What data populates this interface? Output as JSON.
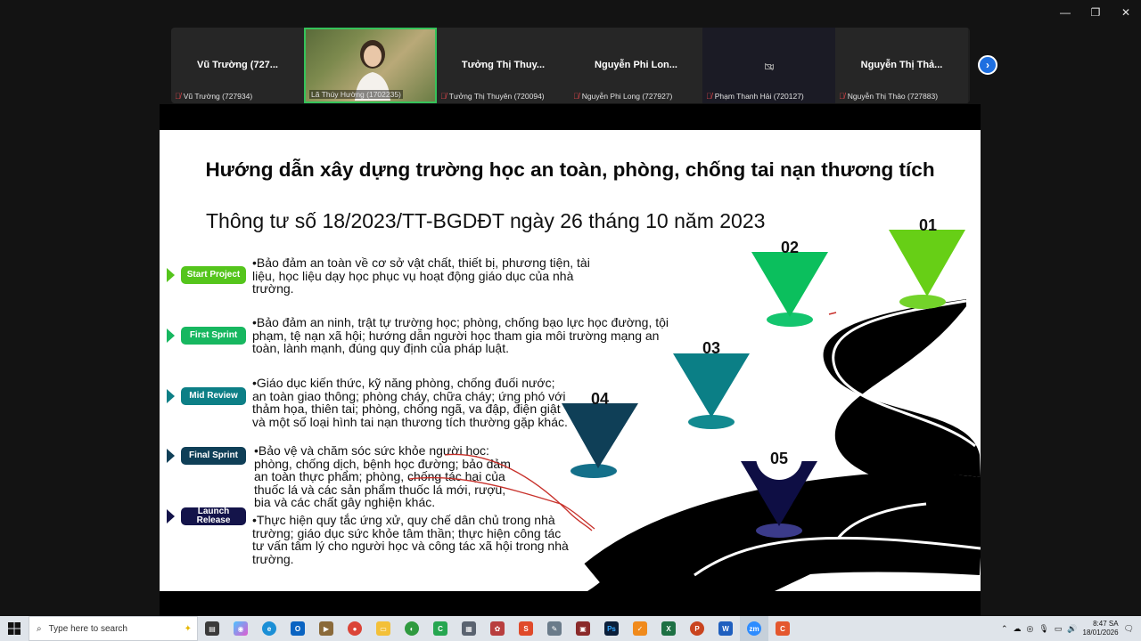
{
  "window": {
    "minimize": "—",
    "restore": "❐",
    "close": "✕"
  },
  "participants": [
    {
      "name": "Vũ Trường (727...",
      "label": "Vũ Trường (727934)",
      "type": "name"
    },
    {
      "name": "",
      "label": "Lã Thúy Hường (1702235)",
      "type": "video"
    },
    {
      "name": "Tưởng Thị Thuy...",
      "label": "Tưởng Thị Thuyên (720094)",
      "type": "name"
    },
    {
      "name": "Nguyễn Phi Lon...",
      "label": "Nguyễn Phi Long (727927)",
      "type": "name"
    },
    {
      "name": "",
      "label": "Phạm Thanh Hải (720127)",
      "type": "camoff"
    },
    {
      "name": "Nguyễn Thị Thả...",
      "label": "Nguyễn Thị Thảo (727883)",
      "type": "name"
    }
  ],
  "slide": {
    "title": "Hướng dẫn xây dựng trường học an toàn, phòng, chống tai nạn thương tích",
    "subtitle": "Thông tư số 18/2023/TT-BGDĐT ngày 26 tháng 10 năm 2023",
    "steps": [
      {
        "label": "Start Project",
        "color": "#55c51c"
      },
      {
        "label": "First Sprint",
        "color": "#17b760"
      },
      {
        "label": "Mid Review",
        "color": "#0d7f86"
      },
      {
        "label": "Final Sprint",
        "color": "#0f3f57"
      },
      {
        "label": "Launch Release",
        "color": "#14144a"
      }
    ],
    "paragraphs": [
      "•Bảo đảm an toàn về cơ sở vật chất, thiết bị, phương tiện, tài liệu, học liệu dạy học phục vụ hoạt động giáo dục của nhà trường.",
      "•Bảo đảm an ninh, trật tự trường học; phòng, chống bạo lực học đường, tội phạm, tệ nạn xã hội; hướng dẫn người học tham gia môi trường mạng an toàn, lành mạnh, đúng quy định của pháp luật.",
      "•Giáo dục kiến thức, kỹ năng phòng, chống đuối nước; an toàn giao thông; phòng cháy, chữa cháy; ứng phó với thảm họa, thiên tai; phòng, chống ngã, va đập, điện giật và một số loại hình tai nạn thương tích thường gặp khác.",
      "•Bảo vệ và chăm sóc sức khỏe người học: phòng, chống dịch, bệnh học đường; bảo đảm an toàn thực phẩm; phòng, chống tác hại của thuốc lá và các sản phẩm thuốc lá mới, rượu, bia và các chất gây nghiện khác.",
      "•Thực hiện quy tắc ứng xử, quy chế dân chủ trong nhà trường; giáo dục sức khỏe tâm thần; thực hiện công tác tư vấn tâm lý cho người học và công tác xã hội trong nhà trường."
    ],
    "numbers": [
      "01",
      "02",
      "03",
      "04",
      "05"
    ]
  },
  "taskbar": {
    "search_placeholder": "Type here to search",
    "time": "8:47 SA",
    "date": "18/01/2026"
  }
}
